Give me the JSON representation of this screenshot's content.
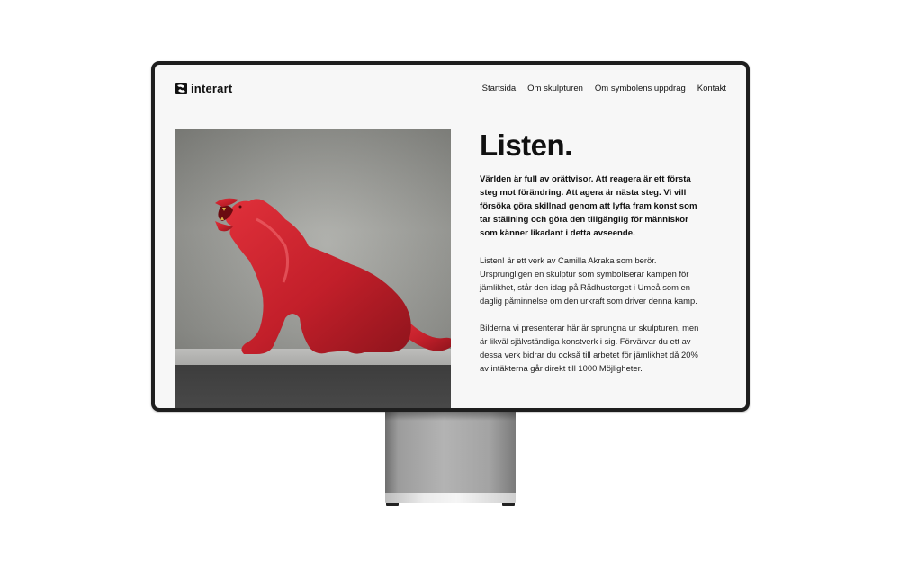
{
  "site": {
    "logo_text": "interart"
  },
  "nav": {
    "items": [
      {
        "label": "Startsida"
      },
      {
        "label": "Om skulpturen"
      },
      {
        "label": "Om symbolens uppdrag"
      },
      {
        "label": "Kontakt"
      }
    ]
  },
  "hero": {
    "next_icon": "chevron-right-icon",
    "sculpture_color": "#c8202a"
  },
  "content": {
    "title": "Listen.",
    "intro": "Världen är full av orättvisor. Att reagera är ett första steg mot förändring. Att agera är nästa steg. Vi vill försöka göra skillnad genom att lyfta fram konst som tar ställning och göra den tillgänglig för människor som känner likadant i detta avseende.",
    "paragraphs": [
      "Listen! är ett verk av Camilla Akraka som berör. Ursprungligen en skulptur som symboliserar kampen för jämlikhet, står den idag på Rådhustorget i Umeå som en daglig påminnelse om den urkraft som driver denna kamp.",
      "Bilderna vi presenterar här är sprungna ur skulpturen, men är likväl självständiga konstverk i sig. Förvärvar du ett av dessa verk bidrar du också till arbetet för jämlikhet då 20% av intäkterna går direkt till 1000 Möjligheter."
    ]
  },
  "colors": {
    "frame": "#1e1e1e",
    "screen_bg": "#f7f7f7",
    "text": "#111111"
  }
}
